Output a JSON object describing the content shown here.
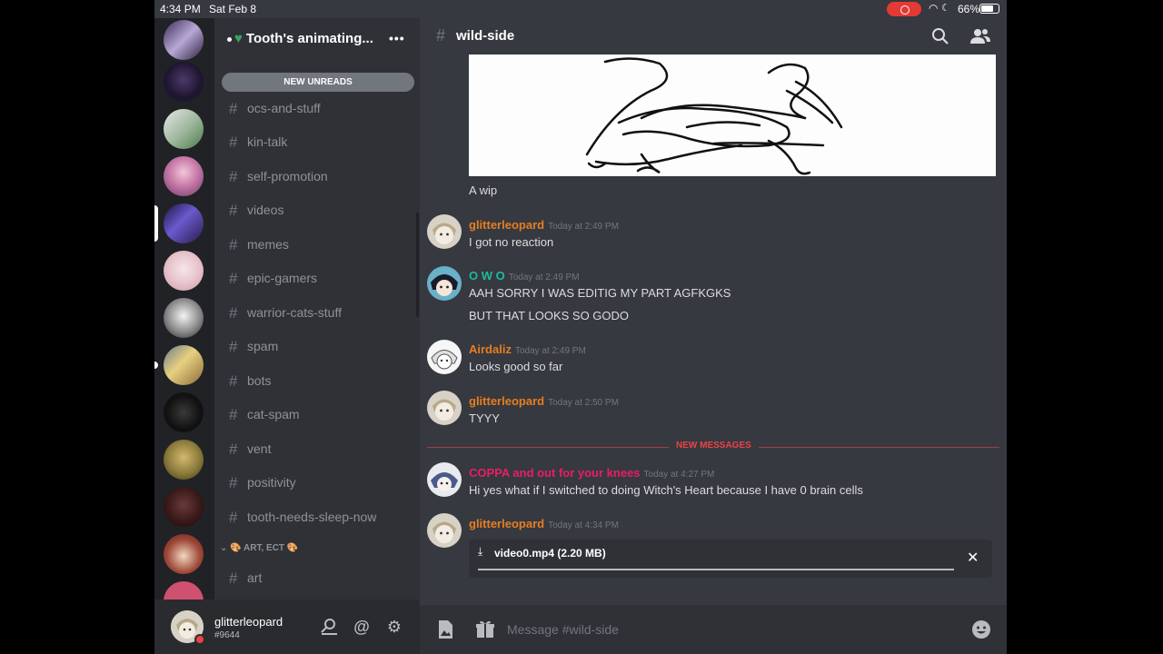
{
  "status_bar": {
    "time": "4:34 PM",
    "date": "Sat Feb 8",
    "battery": "66%"
  },
  "server": {
    "name": "Tooth's animating...",
    "new_unreads": "NEW UNREADS"
  },
  "channels": [
    "ocs-and-stuff",
    "kin-talk",
    "self-promotion",
    "videos",
    "memes",
    "epic-gamers",
    "warrior-cats-stuff",
    "spam",
    "bots",
    "cat-spam",
    "vent",
    "positivity",
    "tooth-needs-sleep-now"
  ],
  "category": {
    "name": "🎨 ART, ECT 🎨",
    "channels": [
      "art"
    ]
  },
  "user": {
    "name": "glitterleopard",
    "tag": "#9644"
  },
  "header": {
    "channel": "wild-side"
  },
  "messages": [
    {
      "caption": "A wip"
    },
    {
      "author": "glitterleopard",
      "time": "Today at 2:49 PM",
      "lines": [
        "I got no reaction"
      ]
    },
    {
      "author": "O W O",
      "time": "Today at 2:49 PM",
      "lines": [
        "AAH SORRY I WAS EDITIG MY PART AGFKGKS",
        "BUT THAT  LOOKS SO GODO"
      ]
    },
    {
      "author": "Airdaliz",
      "time": "Today at 2:49 PM",
      "lines": [
        "Looks good so far"
      ]
    },
    {
      "author": "glitterleopard",
      "time": "Today at 2:50 PM",
      "lines": [
        "TYYY"
      ]
    },
    {
      "author": "COPPA and out for your knees",
      "time": "Today at 4:27 PM",
      "lines": [
        "Hi yes what if I switched to doing Witch's Heart because I have 0 brain cells"
      ]
    },
    {
      "author": "glitterleopard",
      "time": "Today at 4:34 PM",
      "lines": []
    }
  ],
  "new_messages_label": "NEW MESSAGES",
  "upload": {
    "filename": "video0.mp4",
    "size": "(2.20 MB)"
  },
  "composer": {
    "placeholder": "Message #wild-side"
  },
  "colors": {
    "glitterleopard": "#e67e22",
    "owo": "#1abc9c",
    "airdaliz": "#e67e22",
    "coppa": "#e91e63",
    "new_messages": "#ed4245"
  }
}
